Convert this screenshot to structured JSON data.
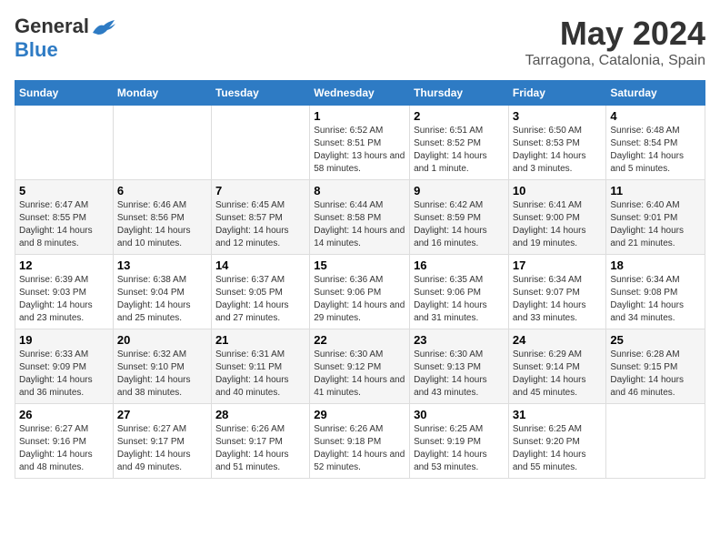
{
  "logo": {
    "general": "General",
    "blue": "Blue"
  },
  "title": "May 2024",
  "subtitle": "Tarragona, Catalonia, Spain",
  "days_of_week": [
    "Sunday",
    "Monday",
    "Tuesday",
    "Wednesday",
    "Thursday",
    "Friday",
    "Saturday"
  ],
  "weeks": [
    [
      {
        "num": "",
        "sunrise": "",
        "sunset": "",
        "daylight": ""
      },
      {
        "num": "",
        "sunrise": "",
        "sunset": "",
        "daylight": ""
      },
      {
        "num": "",
        "sunrise": "",
        "sunset": "",
        "daylight": ""
      },
      {
        "num": "1",
        "sunrise": "Sunrise: 6:52 AM",
        "sunset": "Sunset: 8:51 PM",
        "daylight": "Daylight: 13 hours and 58 minutes."
      },
      {
        "num": "2",
        "sunrise": "Sunrise: 6:51 AM",
        "sunset": "Sunset: 8:52 PM",
        "daylight": "Daylight: 14 hours and 1 minute."
      },
      {
        "num": "3",
        "sunrise": "Sunrise: 6:50 AM",
        "sunset": "Sunset: 8:53 PM",
        "daylight": "Daylight: 14 hours and 3 minutes."
      },
      {
        "num": "4",
        "sunrise": "Sunrise: 6:48 AM",
        "sunset": "Sunset: 8:54 PM",
        "daylight": "Daylight: 14 hours and 5 minutes."
      }
    ],
    [
      {
        "num": "5",
        "sunrise": "Sunrise: 6:47 AM",
        "sunset": "Sunset: 8:55 PM",
        "daylight": "Daylight: 14 hours and 8 minutes."
      },
      {
        "num": "6",
        "sunrise": "Sunrise: 6:46 AM",
        "sunset": "Sunset: 8:56 PM",
        "daylight": "Daylight: 14 hours and 10 minutes."
      },
      {
        "num": "7",
        "sunrise": "Sunrise: 6:45 AM",
        "sunset": "Sunset: 8:57 PM",
        "daylight": "Daylight: 14 hours and 12 minutes."
      },
      {
        "num": "8",
        "sunrise": "Sunrise: 6:44 AM",
        "sunset": "Sunset: 8:58 PM",
        "daylight": "Daylight: 14 hours and 14 minutes."
      },
      {
        "num": "9",
        "sunrise": "Sunrise: 6:42 AM",
        "sunset": "Sunset: 8:59 PM",
        "daylight": "Daylight: 14 hours and 16 minutes."
      },
      {
        "num": "10",
        "sunrise": "Sunrise: 6:41 AM",
        "sunset": "Sunset: 9:00 PM",
        "daylight": "Daylight: 14 hours and 19 minutes."
      },
      {
        "num": "11",
        "sunrise": "Sunrise: 6:40 AM",
        "sunset": "Sunset: 9:01 PM",
        "daylight": "Daylight: 14 hours and 21 minutes."
      }
    ],
    [
      {
        "num": "12",
        "sunrise": "Sunrise: 6:39 AM",
        "sunset": "Sunset: 9:03 PM",
        "daylight": "Daylight: 14 hours and 23 minutes."
      },
      {
        "num": "13",
        "sunrise": "Sunrise: 6:38 AM",
        "sunset": "Sunset: 9:04 PM",
        "daylight": "Daylight: 14 hours and 25 minutes."
      },
      {
        "num": "14",
        "sunrise": "Sunrise: 6:37 AM",
        "sunset": "Sunset: 9:05 PM",
        "daylight": "Daylight: 14 hours and 27 minutes."
      },
      {
        "num": "15",
        "sunrise": "Sunrise: 6:36 AM",
        "sunset": "Sunset: 9:06 PM",
        "daylight": "Daylight: 14 hours and 29 minutes."
      },
      {
        "num": "16",
        "sunrise": "Sunrise: 6:35 AM",
        "sunset": "Sunset: 9:06 PM",
        "daylight": "Daylight: 14 hours and 31 minutes."
      },
      {
        "num": "17",
        "sunrise": "Sunrise: 6:34 AM",
        "sunset": "Sunset: 9:07 PM",
        "daylight": "Daylight: 14 hours and 33 minutes."
      },
      {
        "num": "18",
        "sunrise": "Sunrise: 6:34 AM",
        "sunset": "Sunset: 9:08 PM",
        "daylight": "Daylight: 14 hours and 34 minutes."
      }
    ],
    [
      {
        "num": "19",
        "sunrise": "Sunrise: 6:33 AM",
        "sunset": "Sunset: 9:09 PM",
        "daylight": "Daylight: 14 hours and 36 minutes."
      },
      {
        "num": "20",
        "sunrise": "Sunrise: 6:32 AM",
        "sunset": "Sunset: 9:10 PM",
        "daylight": "Daylight: 14 hours and 38 minutes."
      },
      {
        "num": "21",
        "sunrise": "Sunrise: 6:31 AM",
        "sunset": "Sunset: 9:11 PM",
        "daylight": "Daylight: 14 hours and 40 minutes."
      },
      {
        "num": "22",
        "sunrise": "Sunrise: 6:30 AM",
        "sunset": "Sunset: 9:12 PM",
        "daylight": "Daylight: 14 hours and 41 minutes."
      },
      {
        "num": "23",
        "sunrise": "Sunrise: 6:30 AM",
        "sunset": "Sunset: 9:13 PM",
        "daylight": "Daylight: 14 hours and 43 minutes."
      },
      {
        "num": "24",
        "sunrise": "Sunrise: 6:29 AM",
        "sunset": "Sunset: 9:14 PM",
        "daylight": "Daylight: 14 hours and 45 minutes."
      },
      {
        "num": "25",
        "sunrise": "Sunrise: 6:28 AM",
        "sunset": "Sunset: 9:15 PM",
        "daylight": "Daylight: 14 hours and 46 minutes."
      }
    ],
    [
      {
        "num": "26",
        "sunrise": "Sunrise: 6:27 AM",
        "sunset": "Sunset: 9:16 PM",
        "daylight": "Daylight: 14 hours and 48 minutes."
      },
      {
        "num": "27",
        "sunrise": "Sunrise: 6:27 AM",
        "sunset": "Sunset: 9:17 PM",
        "daylight": "Daylight: 14 hours and 49 minutes."
      },
      {
        "num": "28",
        "sunrise": "Sunrise: 6:26 AM",
        "sunset": "Sunset: 9:17 PM",
        "daylight": "Daylight: 14 hours and 51 minutes."
      },
      {
        "num": "29",
        "sunrise": "Sunrise: 6:26 AM",
        "sunset": "Sunset: 9:18 PM",
        "daylight": "Daylight: 14 hours and 52 minutes."
      },
      {
        "num": "30",
        "sunrise": "Sunrise: 6:25 AM",
        "sunset": "Sunset: 9:19 PM",
        "daylight": "Daylight: 14 hours and 53 minutes."
      },
      {
        "num": "31",
        "sunrise": "Sunrise: 6:25 AM",
        "sunset": "Sunset: 9:20 PM",
        "daylight": "Daylight: 14 hours and 55 minutes."
      },
      {
        "num": "",
        "sunrise": "",
        "sunset": "",
        "daylight": ""
      }
    ]
  ]
}
